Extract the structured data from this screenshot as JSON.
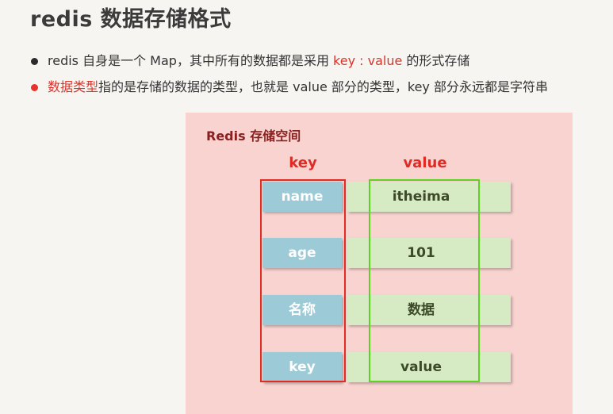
{
  "title": "redis 数据存储格式",
  "bullets": [
    {
      "prefix": "redis 自身是一个 Map，其中所有的数据都是采用 ",
      "highlight": "key : value",
      "suffix": " 的形式存储",
      "dot_color": "#2b2b2b"
    },
    {
      "highlight": "数据类型",
      "suffix": "指的是存储的数据的类型，也就是 value 部分的类型，key 部分永远都是字符串",
      "dot_color": "#e8322b"
    }
  ],
  "diagram": {
    "title": "Redis 存储空间",
    "key_header": "key",
    "value_header": "value",
    "rows": [
      {
        "key": "name",
        "value": "itheima"
      },
      {
        "key": "age",
        "value": "101"
      },
      {
        "key": "名称",
        "value": "数据"
      },
      {
        "key": "key",
        "value": "value"
      }
    ],
    "colors": {
      "panel_bg": "#f8d3d0",
      "key_cell": "#9ccad6",
      "value_cell": "#d6eac4",
      "key_frame": "#e32b22",
      "value_frame": "#5bd421",
      "accent_red": "#d9352a"
    }
  }
}
